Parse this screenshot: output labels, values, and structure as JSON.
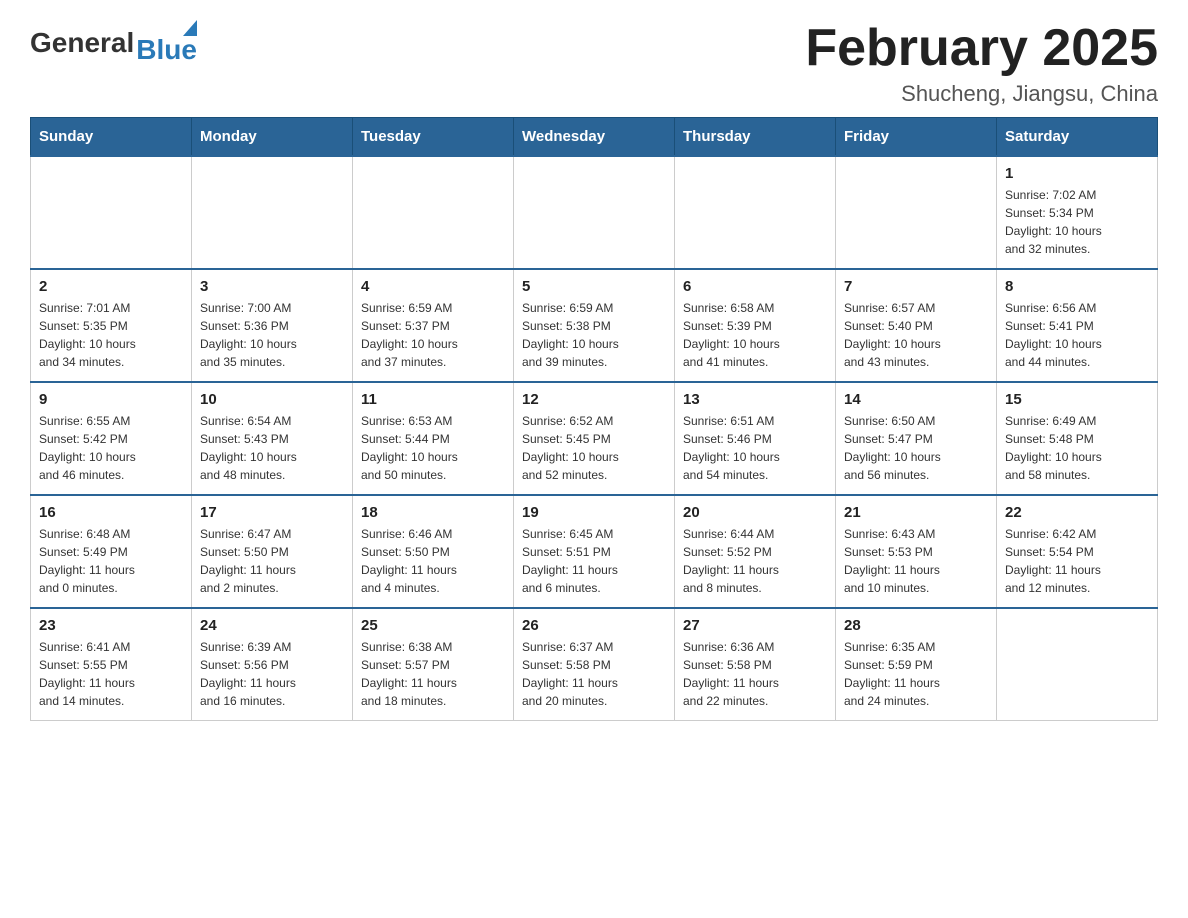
{
  "logo": {
    "general": "General",
    "blue": "Blue"
  },
  "header": {
    "month_year": "February 2025",
    "location": "Shucheng, Jiangsu, China"
  },
  "weekdays": [
    "Sunday",
    "Monday",
    "Tuesday",
    "Wednesday",
    "Thursday",
    "Friday",
    "Saturday"
  ],
  "weeks": [
    [
      {
        "day": "",
        "info": ""
      },
      {
        "day": "",
        "info": ""
      },
      {
        "day": "",
        "info": ""
      },
      {
        "day": "",
        "info": ""
      },
      {
        "day": "",
        "info": ""
      },
      {
        "day": "",
        "info": ""
      },
      {
        "day": "1",
        "info": "Sunrise: 7:02 AM\nSunset: 5:34 PM\nDaylight: 10 hours\nand 32 minutes."
      }
    ],
    [
      {
        "day": "2",
        "info": "Sunrise: 7:01 AM\nSunset: 5:35 PM\nDaylight: 10 hours\nand 34 minutes."
      },
      {
        "day": "3",
        "info": "Sunrise: 7:00 AM\nSunset: 5:36 PM\nDaylight: 10 hours\nand 35 minutes."
      },
      {
        "day": "4",
        "info": "Sunrise: 6:59 AM\nSunset: 5:37 PM\nDaylight: 10 hours\nand 37 minutes."
      },
      {
        "day": "5",
        "info": "Sunrise: 6:59 AM\nSunset: 5:38 PM\nDaylight: 10 hours\nand 39 minutes."
      },
      {
        "day": "6",
        "info": "Sunrise: 6:58 AM\nSunset: 5:39 PM\nDaylight: 10 hours\nand 41 minutes."
      },
      {
        "day": "7",
        "info": "Sunrise: 6:57 AM\nSunset: 5:40 PM\nDaylight: 10 hours\nand 43 minutes."
      },
      {
        "day": "8",
        "info": "Sunrise: 6:56 AM\nSunset: 5:41 PM\nDaylight: 10 hours\nand 44 minutes."
      }
    ],
    [
      {
        "day": "9",
        "info": "Sunrise: 6:55 AM\nSunset: 5:42 PM\nDaylight: 10 hours\nand 46 minutes."
      },
      {
        "day": "10",
        "info": "Sunrise: 6:54 AM\nSunset: 5:43 PM\nDaylight: 10 hours\nand 48 minutes."
      },
      {
        "day": "11",
        "info": "Sunrise: 6:53 AM\nSunset: 5:44 PM\nDaylight: 10 hours\nand 50 minutes."
      },
      {
        "day": "12",
        "info": "Sunrise: 6:52 AM\nSunset: 5:45 PM\nDaylight: 10 hours\nand 52 minutes."
      },
      {
        "day": "13",
        "info": "Sunrise: 6:51 AM\nSunset: 5:46 PM\nDaylight: 10 hours\nand 54 minutes."
      },
      {
        "day": "14",
        "info": "Sunrise: 6:50 AM\nSunset: 5:47 PM\nDaylight: 10 hours\nand 56 minutes."
      },
      {
        "day": "15",
        "info": "Sunrise: 6:49 AM\nSunset: 5:48 PM\nDaylight: 10 hours\nand 58 minutes."
      }
    ],
    [
      {
        "day": "16",
        "info": "Sunrise: 6:48 AM\nSunset: 5:49 PM\nDaylight: 11 hours\nand 0 minutes."
      },
      {
        "day": "17",
        "info": "Sunrise: 6:47 AM\nSunset: 5:50 PM\nDaylight: 11 hours\nand 2 minutes."
      },
      {
        "day": "18",
        "info": "Sunrise: 6:46 AM\nSunset: 5:50 PM\nDaylight: 11 hours\nand 4 minutes."
      },
      {
        "day": "19",
        "info": "Sunrise: 6:45 AM\nSunset: 5:51 PM\nDaylight: 11 hours\nand 6 minutes."
      },
      {
        "day": "20",
        "info": "Sunrise: 6:44 AM\nSunset: 5:52 PM\nDaylight: 11 hours\nand 8 minutes."
      },
      {
        "day": "21",
        "info": "Sunrise: 6:43 AM\nSunset: 5:53 PM\nDaylight: 11 hours\nand 10 minutes."
      },
      {
        "day": "22",
        "info": "Sunrise: 6:42 AM\nSunset: 5:54 PM\nDaylight: 11 hours\nand 12 minutes."
      }
    ],
    [
      {
        "day": "23",
        "info": "Sunrise: 6:41 AM\nSunset: 5:55 PM\nDaylight: 11 hours\nand 14 minutes."
      },
      {
        "day": "24",
        "info": "Sunrise: 6:39 AM\nSunset: 5:56 PM\nDaylight: 11 hours\nand 16 minutes."
      },
      {
        "day": "25",
        "info": "Sunrise: 6:38 AM\nSunset: 5:57 PM\nDaylight: 11 hours\nand 18 minutes."
      },
      {
        "day": "26",
        "info": "Sunrise: 6:37 AM\nSunset: 5:58 PM\nDaylight: 11 hours\nand 20 minutes."
      },
      {
        "day": "27",
        "info": "Sunrise: 6:36 AM\nSunset: 5:58 PM\nDaylight: 11 hours\nand 22 minutes."
      },
      {
        "day": "28",
        "info": "Sunrise: 6:35 AM\nSunset: 5:59 PM\nDaylight: 11 hours\nand 24 minutes."
      },
      {
        "day": "",
        "info": ""
      }
    ]
  ]
}
